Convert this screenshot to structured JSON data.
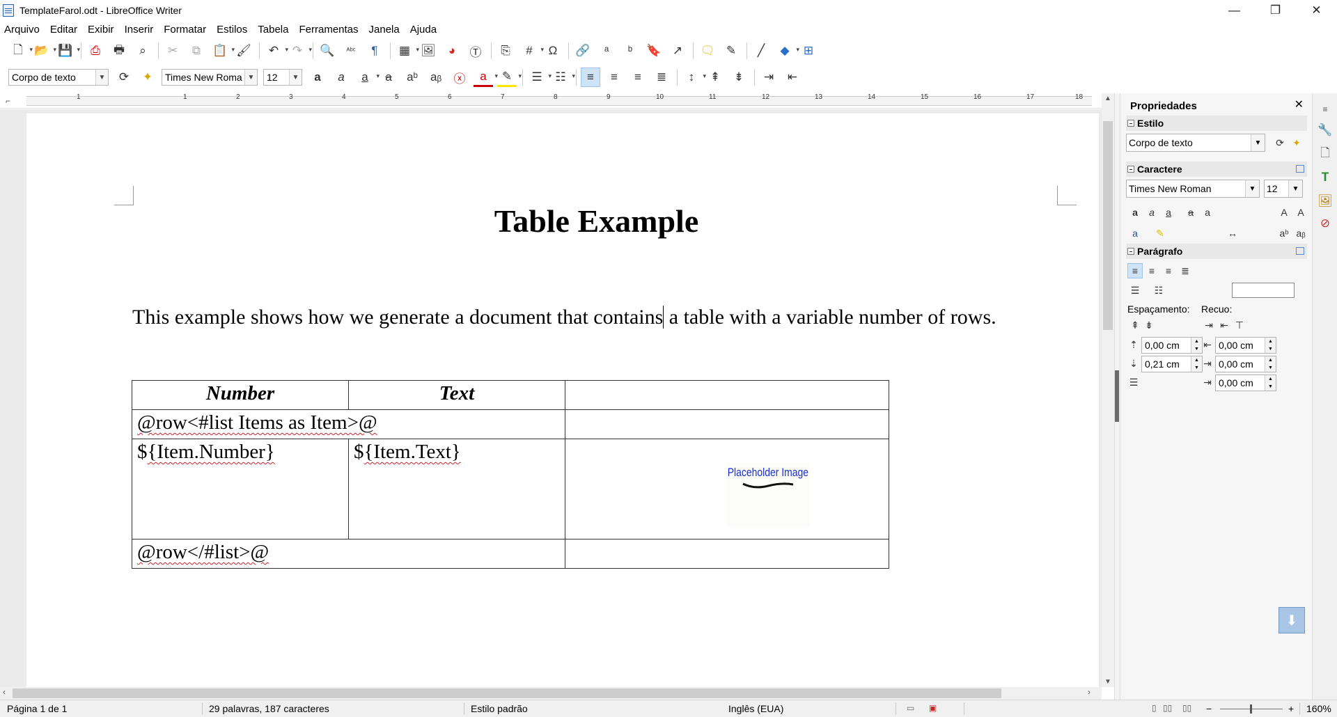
{
  "window": {
    "title": "TemplateFarol.odt - LibreOffice Writer",
    "minimize": "—",
    "restore": "❐",
    "close": "✕"
  },
  "menubar": [
    "Arquivo",
    "Editar",
    "Exibir",
    "Inserir",
    "Formatar",
    "Estilos",
    "Tabela",
    "Ferramentas",
    "Janela",
    "Ajuda"
  ],
  "formatting": {
    "paragraph_style": "Corpo de texto",
    "font_name": "Times New Roma",
    "font_size": "12"
  },
  "ruler": {
    "numbers": [
      "1",
      "1",
      "2",
      "3",
      "4",
      "5",
      "6",
      "7",
      "8",
      "9",
      "10",
      "11",
      "12",
      "13",
      "14",
      "15",
      "16",
      "17",
      "18"
    ]
  },
  "document": {
    "title": "Table Example",
    "paragraph_before": "This example shows how we generate a document that contains",
    "paragraph_after": " a table with a variable number of rows.",
    "table": {
      "header_number": "Number",
      "header_text": "Text",
      "row_start": "@row<#list Items as Item>@",
      "item_number_prefix": "$",
      "item_number": "{Item.Number}",
      "item_text_prefix": "$",
      "item_text": "{Item.Text}",
      "placeholder_image_text": "Placeholder Image",
      "row_end": "@row</#list>@"
    }
  },
  "sidebar": {
    "title": "Propriedades",
    "close": "✕",
    "style_section": "Estilo",
    "style_value": "Corpo de texto",
    "character_section": "Caractere",
    "font_name": "Times New Roman",
    "font_size": "12",
    "paragraph_section": "Parágrafo",
    "spacing_label": "Espaçamento:",
    "indent_label": "Recuo:",
    "spacing_above": "0,00 cm",
    "spacing_below": "0,21 cm",
    "indent_before": "0,00 cm",
    "indent_after": "0,00 cm",
    "indent_first": "0,00 cm"
  },
  "statusbar": {
    "page": "Página 1 de 1",
    "words": "29 palavras, 187 caracteres",
    "page_style": "Estilo padrão",
    "language": "Inglês (EUA)",
    "zoom": "160%"
  }
}
